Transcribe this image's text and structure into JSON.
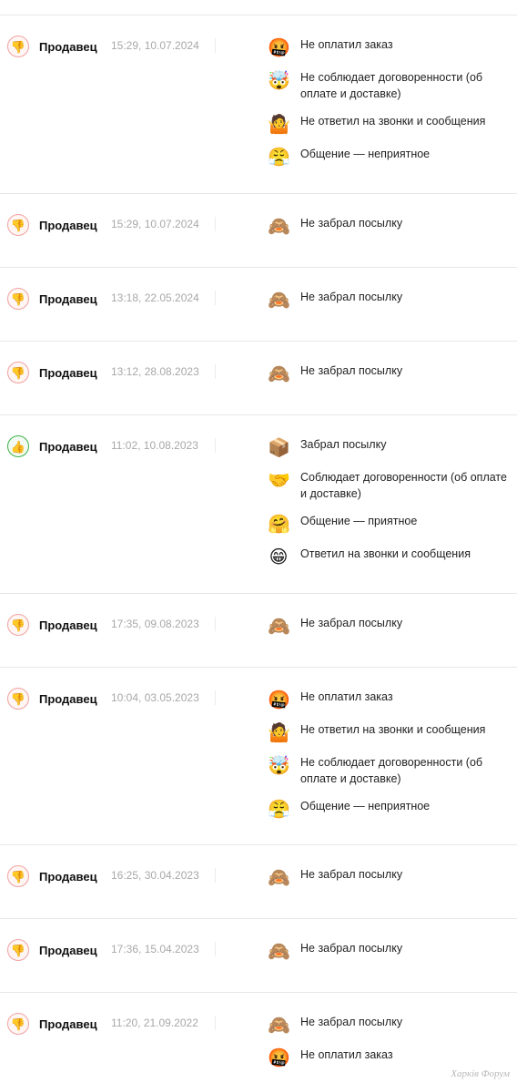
{
  "reviews": [
    {
      "verdict": "negative",
      "verdict_icon": "thumbs-down",
      "role": "Продавец",
      "date": "15:29, 10.07.2024",
      "tags": [
        {
          "icon": "angry-face",
          "glyph": "🤬",
          "text": "Не оплатил заказ"
        },
        {
          "icon": "exploding-head",
          "glyph": "🤯",
          "text": "Не соблюдает договоренности (об оплате и доставке)"
        },
        {
          "icon": "shrug",
          "glyph": "🤷",
          "text": "Не ответил на звонки и сообщения"
        },
        {
          "icon": "steam-face",
          "glyph": "😤",
          "text": "Общение — неприятное"
        }
      ]
    },
    {
      "verdict": "negative",
      "verdict_icon": "thumbs-down",
      "role": "Продавец",
      "date": "15:29, 10.07.2024",
      "tags": [
        {
          "icon": "see-no-evil-monkey",
          "glyph": "🙈",
          "text": "Не забрал посылку"
        }
      ]
    },
    {
      "verdict": "negative",
      "verdict_icon": "thumbs-down",
      "role": "Продавец",
      "date": "13:18, 22.05.2024",
      "tags": [
        {
          "icon": "see-no-evil-monkey",
          "glyph": "🙈",
          "text": "Не забрал посылку"
        }
      ]
    },
    {
      "verdict": "negative",
      "verdict_icon": "thumbs-down",
      "role": "Продавец",
      "date": "13:12, 28.08.2023",
      "tags": [
        {
          "icon": "see-no-evil-monkey",
          "glyph": "🙈",
          "text": "Не забрал посылку"
        }
      ]
    },
    {
      "verdict": "positive",
      "verdict_icon": "thumbs-up",
      "role": "Продавец",
      "date": "11:02, 10.08.2023",
      "tags": [
        {
          "icon": "package",
          "glyph": "📦",
          "text": "Забрал посылку"
        },
        {
          "icon": "handshake",
          "glyph": "🤝",
          "text": "Соблюдает договоренности (об оплате и доставке)"
        },
        {
          "icon": "hugging-face",
          "glyph": "🤗",
          "text": "Общение — приятное"
        },
        {
          "icon": "grinning-face",
          "glyph": "😁",
          "text": "Ответил на звонки и сообщения"
        }
      ]
    },
    {
      "verdict": "negative",
      "verdict_icon": "thumbs-down",
      "role": "Продавец",
      "date": "17:35, 09.08.2023",
      "tags": [
        {
          "icon": "see-no-evil-monkey",
          "glyph": "🙈",
          "text": "Не забрал посылку"
        }
      ]
    },
    {
      "verdict": "negative",
      "verdict_icon": "thumbs-down",
      "role": "Продавец",
      "date": "10:04, 03.05.2023",
      "tags": [
        {
          "icon": "angry-face",
          "glyph": "🤬",
          "text": "Не оплатил заказ"
        },
        {
          "icon": "shrug",
          "glyph": "🤷",
          "text": "Не ответил на звонки и сообщения"
        },
        {
          "icon": "exploding-head",
          "glyph": "🤯",
          "text": "Не соблюдает договоренности (об оплате и доставке)"
        },
        {
          "icon": "steam-face",
          "glyph": "😤",
          "text": "Общение — неприятное"
        }
      ]
    },
    {
      "verdict": "negative",
      "verdict_icon": "thumbs-down",
      "role": "Продавец",
      "date": "16:25, 30.04.2023",
      "tags": [
        {
          "icon": "see-no-evil-monkey",
          "glyph": "🙈",
          "text": "Не забрал посылку"
        }
      ]
    },
    {
      "verdict": "negative",
      "verdict_icon": "thumbs-down",
      "role": "Продавец",
      "date": "17:36, 15.04.2023",
      "tags": [
        {
          "icon": "see-no-evil-monkey",
          "glyph": "🙈",
          "text": "Не забрал посылку"
        }
      ]
    },
    {
      "verdict": "negative",
      "verdict_icon": "thumbs-down",
      "role": "Продавец",
      "date": "11:20, 21.09.2022",
      "tags": [
        {
          "icon": "see-no-evil-monkey",
          "glyph": "🙈",
          "text": "Не забрал посылку"
        },
        {
          "icon": "angry-face",
          "glyph": "🤬",
          "text": "Не оплатил заказ"
        }
      ]
    }
  ],
  "watermark": "Харків Форум",
  "colors": {
    "negative_ring": "#f0a0a0",
    "positive_ring": "#3cb34a",
    "date": "#a8a8a8",
    "divider": "#e6e6e6"
  }
}
